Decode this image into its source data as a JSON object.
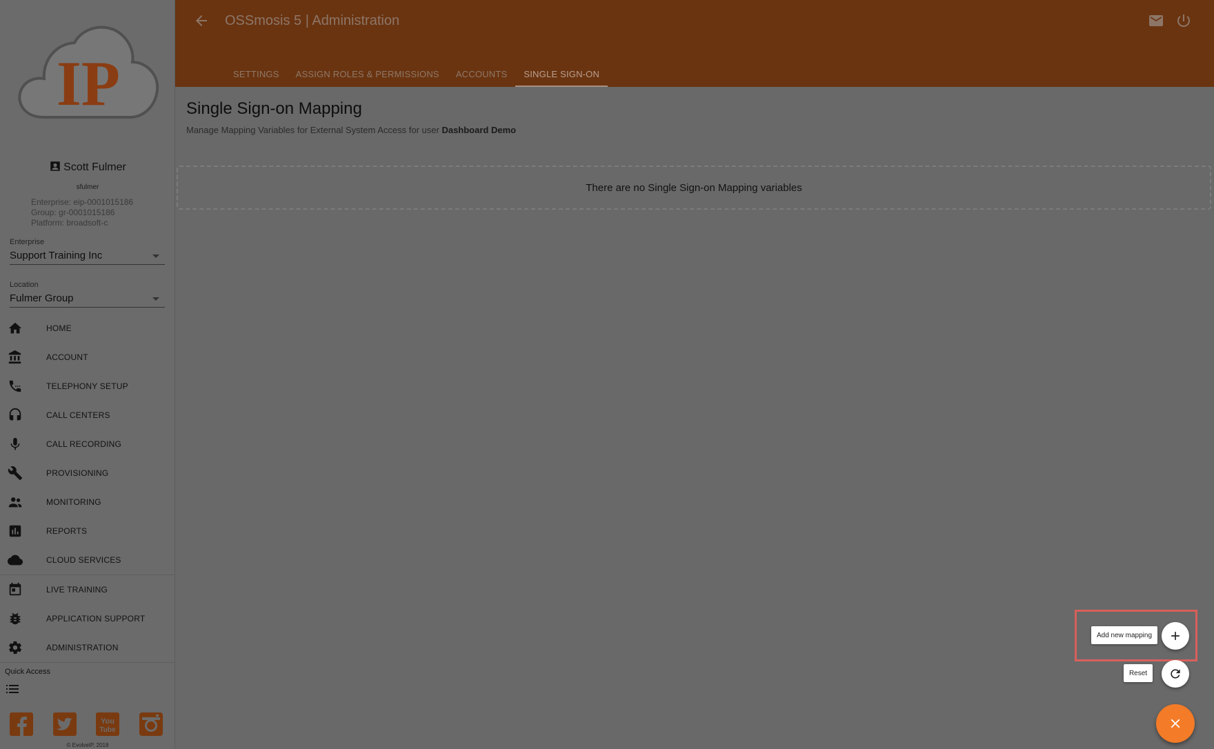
{
  "logo": {
    "text": "IP"
  },
  "user": {
    "name": "Scott Fulmer",
    "login": "sfulmer",
    "enterprise_line": "Enterprise: eip-0001015186",
    "group_line": "Group: gr-0001015186",
    "platform_line": "Platform: broadsoft-c"
  },
  "enterprise": {
    "label": "Enterprise",
    "value": "Support Training Inc"
  },
  "location": {
    "label": "Location",
    "value": "Fulmer Group"
  },
  "nav": [
    {
      "label": "HOME",
      "icon": "home-icon"
    },
    {
      "label": "ACCOUNT",
      "icon": "bank-icon"
    },
    {
      "label": "TELEPHONY SETUP",
      "icon": "phone-icon"
    },
    {
      "label": "CALL CENTERS",
      "icon": "headset-icon"
    },
    {
      "label": "CALL RECORDING",
      "icon": "mic-icon"
    },
    {
      "label": "PROVISIONING",
      "icon": "wrench-icon"
    },
    {
      "label": "MONITORING",
      "icon": "people-icon"
    },
    {
      "label": "REPORTS",
      "icon": "chart-icon"
    },
    {
      "label": "CLOUD SERVICES",
      "icon": "cloud-icon"
    },
    {
      "label": "LIVE TRAINING",
      "icon": "calendar-icon"
    },
    {
      "label": "APPLICATION SUPPORT",
      "icon": "bug-icon"
    },
    {
      "label": "ADMINISTRATION",
      "icon": "gear-icon"
    }
  ],
  "quick_access": {
    "label": "Quick Access"
  },
  "social": [
    "facebook-icon",
    "twitter-icon",
    "youtube-icon",
    "instagram-icon"
  ],
  "copyright": "© EvolveIP, 2018",
  "header": {
    "title": "OSSmosis 5 | Administration",
    "tabs": [
      "SETTINGS",
      "ASSIGN ROLES & PERMISSIONS",
      "ACCOUNTS",
      "SINGLE SIGN-ON"
    ],
    "active_tab": "SINGLE SIGN-ON"
  },
  "main": {
    "title": "Single Sign-on Mapping",
    "subtitle_prefix": "Manage Mapping Variables for External System Access for user",
    "subtitle_user": "Dashboard Demo",
    "empty_message": "There are no Single Sign-on Mapping variables"
  },
  "fab": {
    "add_label": "Add new mapping",
    "reset_label": "Reset"
  },
  "colors": {
    "header_bg": "#6a3411",
    "brand_orange": "#f47b27",
    "highlight": "#d9605a"
  }
}
